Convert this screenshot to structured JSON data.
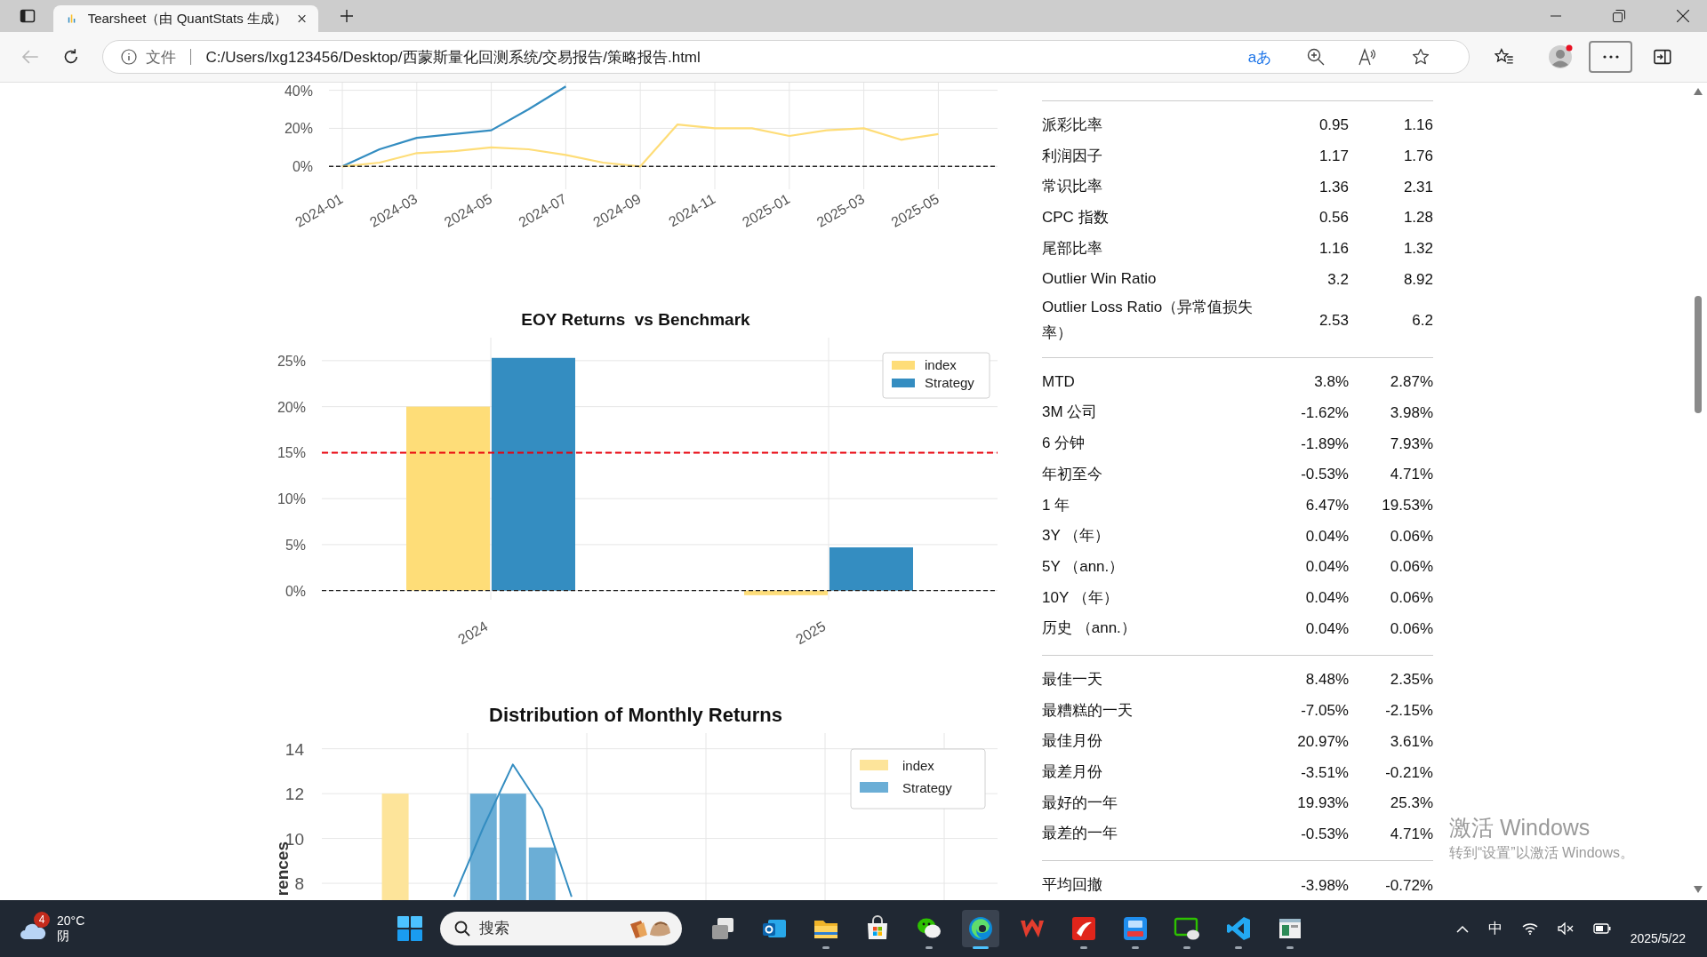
{
  "browser": {
    "tab": {
      "title": "Tearsheet（由 QuantStats 生成）"
    },
    "address": {
      "scheme_label": "文件",
      "url": "C:/Users/lxg123456/Desktop/西蒙斯量化回测系统/交易报告/策略报告.html"
    },
    "translate_label": "aあ"
  },
  "charts": [
    {
      "chart_data": {
        "type": "line",
        "grid": true,
        "categories": [
          "2024-01",
          null,
          "2024-03",
          null,
          "2024-05",
          null,
          "2024-07",
          null,
          "2024-09",
          null,
          "2024-11",
          null,
          "2025-01",
          null,
          "2025-03",
          null,
          "2025-05"
        ],
        "ylim": [
          -12,
          44
        ],
        "ref_lines": [
          {
            "axis": "y",
            "value": 0
          }
        ],
        "yticks": [
          {
            "value": 0,
            "label": "0%"
          },
          {
            "value": 20,
            "label": "20%"
          },
          {
            "value": 40,
            "label": "40%"
          }
        ],
        "series": [
          {
            "color": "#348dc1",
            "values": [
              0,
              9,
              15,
              17,
              19,
              30,
              42,
              null,
              null,
              null,
              null,
              null,
              null,
              null,
              null,
              null,
              null
            ]
          },
          {
            "color": "#fedd78",
            "values": [
              0,
              2,
              7,
              8,
              10,
              9,
              6,
              2,
              0,
              22,
              20,
              20,
              16,
              19,
              20,
              14,
              17
            ]
          }
        ]
      }
    },
    {
      "chart_data": {
        "type": "bar",
        "title": "EOY Returns  vs Benchmark",
        "grid": true,
        "categories": [
          "2024",
          "2025"
        ],
        "ylim": [
          -1,
          27.5
        ],
        "yticks": [
          {
            "value": 0,
            "label": "0%"
          },
          {
            "value": 5,
            "label": "5%"
          },
          {
            "value": 10,
            "label": "10%"
          },
          {
            "value": 15,
            "label": "15%"
          },
          {
            "value": 20,
            "label": "20%"
          },
          {
            "value": 25,
            "label": "25%"
          }
        ],
        "legend": true,
        "ref_lines": [
          {
            "axis": "y",
            "value": 15,
            "color": "#e8000b"
          },
          {
            "axis": "y",
            "value": 0
          }
        ],
        "series": [
          {
            "name": "index",
            "color": "#fedd78",
            "values": [
              20,
              -0.5
            ]
          },
          {
            "name": "Strategy",
            "color": "#348dc1",
            "values": [
              25.3,
              4.7
            ]
          }
        ]
      }
    },
    {
      "chart_data": {
        "type": "bar",
        "title": "Distribution of Monthly Returns",
        "ylabel": "rences",
        "grid": true,
        "categories": [
          null,
          null,
          null,
          null,
          null,
          null,
          null,
          null,
          null,
          null,
          null,
          null,
          null,
          null,
          null,
          null,
          null,
          null,
          null,
          null,
          null,
          null,
          null
        ],
        "ylim": [
          7.25,
          14.7
        ],
        "yticks": [
          8,
          10,
          12,
          14
        ],
        "legend": true,
        "series": [
          {
            "name": "index",
            "color": "#fde49a",
            "values": [
              null,
              null,
              12,
              null,
              null,
              null,
              null,
              null,
              null,
              null,
              null,
              null,
              null,
              null,
              null,
              null,
              null,
              null,
              null,
              null,
              null,
              null,
              null
            ]
          },
          {
            "name": "Strategy",
            "color": "#6baed6",
            "values": [
              null,
              null,
              null,
              null,
              null,
              12,
              12,
              9.6,
              null,
              null,
              null,
              null,
              null,
              null,
              null,
              null,
              null,
              null,
              null,
              null,
              null,
              null,
              null
            ]
          },
          {
            "type": "line",
            "color": "#348dc1",
            "values": [
              null,
              null,
              null,
              null,
              7.4,
              10.5,
              13.3,
              11.3,
              7.4,
              null,
              null,
              null,
              null,
              null,
              null,
              null,
              null,
              null,
              null,
              null,
              null,
              null,
              null
            ]
          }
        ]
      }
    }
  ],
  "metrics": {
    "groups": [
      {
        "rows": [
          {
            "label": "派彩比率",
            "values": [
              "0.95",
              "1.16"
            ]
          },
          {
            "label": "利润因子",
            "values": [
              "1.17",
              "1.76"
            ]
          },
          {
            "label": "常识比率",
            "values": [
              "1.36",
              "2.31"
            ]
          },
          {
            "label": "CPC 指数",
            "values": [
              "0.56",
              "1.28"
            ]
          },
          {
            "label": "尾部比率",
            "values": [
              "1.16",
              "1.32"
            ]
          },
          {
            "label": "Outlier Win Ratio",
            "values": [
              "3.2",
              "8.92"
            ]
          },
          {
            "label": "Outlier Loss Ratio（异常值损失率）",
            "values": [
              "2.53",
              "6.2"
            ]
          }
        ]
      },
      {
        "rows": [
          {
            "label": "MTD",
            "values": [
              "3.8%",
              "2.87%"
            ]
          },
          {
            "label": "3M 公司",
            "values": [
              "-1.62%",
              "3.98%"
            ]
          },
          {
            "label": "6 分钟",
            "values": [
              "-1.89%",
              "7.93%"
            ]
          },
          {
            "label": "年初至今",
            "values": [
              "-0.53%",
              "4.71%"
            ]
          },
          {
            "label": "1 年",
            "values": [
              "6.47%",
              "19.53%"
            ]
          },
          {
            "label": "3Y （年）",
            "values": [
              "0.04%",
              "0.06%"
            ]
          },
          {
            "label": "5Y （ann.）",
            "values": [
              "0.04%",
              "0.06%"
            ]
          },
          {
            "label": "10Y （年）",
            "values": [
              "0.04%",
              "0.06%"
            ]
          },
          {
            "label": "历史 （ann.）",
            "values": [
              "0.04%",
              "0.06%"
            ]
          }
        ]
      },
      {
        "rows": [
          {
            "label": "最佳一天",
            "values": [
              "8.48%",
              "2.35%"
            ]
          },
          {
            "label": "最糟糕的一天",
            "values": [
              "-7.05%",
              "-2.15%"
            ]
          },
          {
            "label": "最佳月份",
            "values": [
              "20.97%",
              "3.61%"
            ]
          },
          {
            "label": "最差月份",
            "values": [
              "-3.51%",
              "-0.21%"
            ]
          },
          {
            "label": "最好的一年",
            "values": [
              "19.93%",
              "25.3%"
            ]
          },
          {
            "label": "最差的一年",
            "values": [
              "-0.53%",
              "4.71%"
            ]
          }
        ]
      },
      {
        "rows": [
          {
            "label": "平均回撤",
            "values": [
              "-3.98%",
              "-0.72%"
            ]
          }
        ]
      }
    ]
  },
  "activation_notice": {
    "title": "激活 Windows",
    "hint": "转到“设置”以激活 Windows。"
  },
  "taskbar": {
    "weather": {
      "badge": "4",
      "temperature": "20°C",
      "condition": "阴"
    },
    "search": {
      "placeholder": "搜索"
    },
    "apps": [
      {
        "kind": "taskview",
        "running": false,
        "selected": false
      },
      {
        "kind": "mail",
        "running": false,
        "selected": false
      },
      {
        "kind": "folder",
        "running": true,
        "selected": false
      },
      {
        "kind": "store",
        "running": false,
        "selected": false
      },
      {
        "kind": "chat",
        "running": true,
        "selected": false
      },
      {
        "kind": "browser",
        "running": true,
        "selected": true
      },
      {
        "kind": "office",
        "running": false,
        "selected": false
      },
      {
        "kind": "ribbon",
        "running": true,
        "selected": false
      },
      {
        "kind": "trading",
        "running": true,
        "selected": false
      },
      {
        "kind": "screenchat",
        "running": true,
        "selected": false
      },
      {
        "kind": "editor",
        "running": true,
        "selected": false
      },
      {
        "kind": "window",
        "running": true,
        "selected": false
      }
    ],
    "tray": {
      "ime": "中",
      "date": "2025/5/22"
    }
  }
}
